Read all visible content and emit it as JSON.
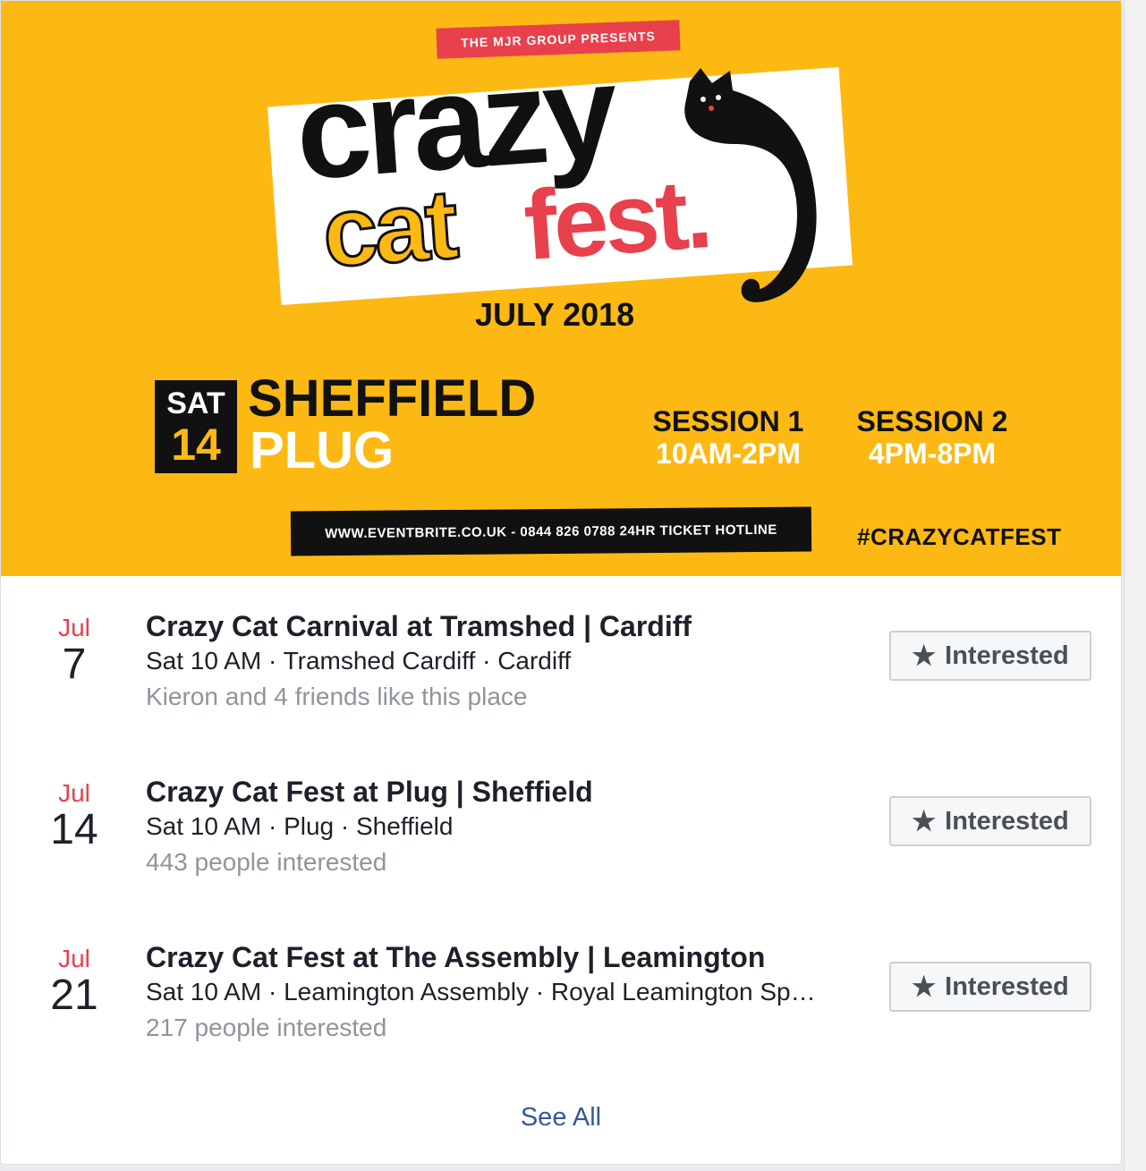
{
  "banner": {
    "presents": "THE MJR GROUP PRESENTS",
    "title_line1": "crazy",
    "title_cat": "cat",
    "title_fest": "fest.",
    "month": "JULY 2018",
    "day_name": "SAT",
    "day_num": "14",
    "city": "SHEFFIELD",
    "venue": "PLUG",
    "session1_title": "SESSION 1",
    "session1_time": "10AM-2PM",
    "session2_title": "SESSION 2",
    "session2_time": "4PM-8PM",
    "hotline": "WWW.EVENTBRITE.CO.UK - 0844 826 0788 24HR TICKET HOTLINE",
    "hashtag": "#CRAZYCATFEST",
    "colors": {
      "background": "#fdb913",
      "accent_red": "#e8404c",
      "black": "#111111"
    }
  },
  "events": [
    {
      "month": "Jul",
      "day": "7",
      "title": "Crazy Cat Carnival at Tramshed | Cardiff",
      "meta": "Sat 10 AM · Tramshed Cardiff · Cardiff",
      "social": "Kieron and 4 friends like this place",
      "button_label": "Interested",
      "button_icon": "star-icon"
    },
    {
      "month": "Jul",
      "day": "14",
      "title": "Crazy Cat Fest at Plug | Sheffield",
      "meta": "Sat 10 AM · Plug · Sheffield",
      "social": "443 people interested",
      "button_label": "Interested",
      "button_icon": "star-icon"
    },
    {
      "month": "Jul",
      "day": "21",
      "title": "Crazy Cat Fest at The Assembly | Leamington",
      "meta": "Sat 10 AM · Leamington Assembly · Royal Leamington Sp…",
      "social": "217 people interested",
      "button_label": "Interested",
      "button_icon": "star-icon"
    }
  ],
  "see_all": "See All",
  "colors": {
    "month": "#e8404c",
    "link": "#365899",
    "muted": "#90949c"
  }
}
